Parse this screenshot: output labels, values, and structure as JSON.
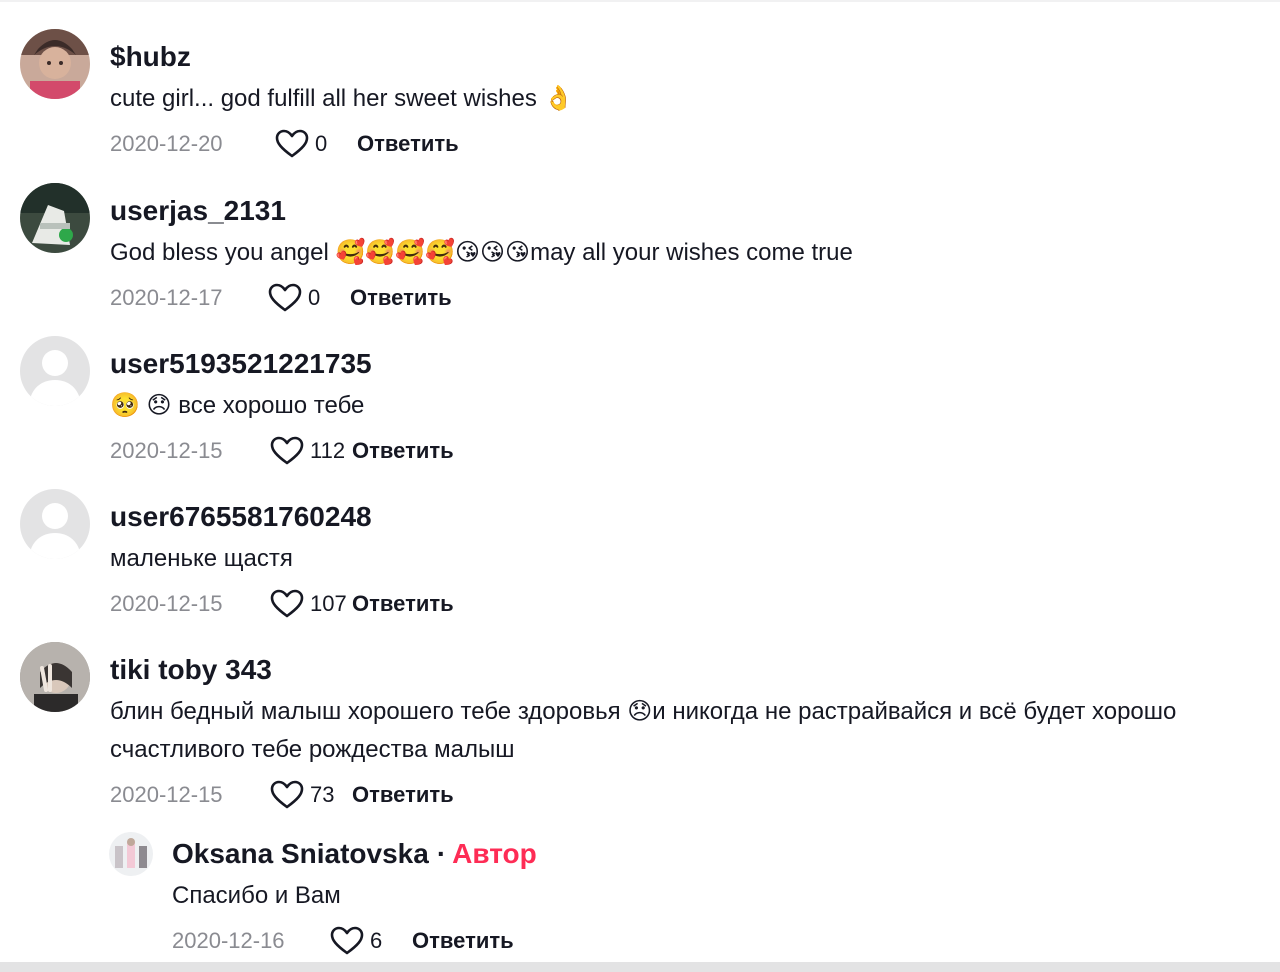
{
  "comments": [
    {
      "username": "$hubz",
      "text": "cute girl... god fulfill all her sweet wishes 👌",
      "date": "2020-12-20",
      "likes": "0",
      "reply_label": "Ответить",
      "avatar": "photo-avatar"
    },
    {
      "username": "userjas_2131",
      "text": "God bless you angel 🥰🥰🥰🥰😘😘😘may all your wishes come true",
      "date": "2020-12-17",
      "likes": "0",
      "reply_label": "Ответить",
      "avatar": "photo-avatar"
    },
    {
      "username": "user5193521221735",
      "text": "🥺 😞 все хорошо тебе",
      "date": "2020-12-15",
      "likes": "112",
      "reply_label": "Ответить",
      "avatar": "default-avatar"
    },
    {
      "username": "user6765581760248",
      "text": "маленьке щастя",
      "date": "2020-12-15",
      "likes": "107",
      "reply_label": "Ответить",
      "avatar": "default-avatar"
    },
    {
      "username": "tiki toby 343",
      "text": "блин бедный малыш хорошего тебе здоровья 😞и никогда не растрайвайся и всё будет хорошо счастливого тебе рождества малыш",
      "date": "2020-12-15",
      "likes": "73",
      "reply_label": "Ответить",
      "avatar": "photo-avatar"
    }
  ],
  "reply": {
    "username": "Oksana Sniatovska",
    "separator": "·",
    "author_tag": "Автор",
    "text": "Спасибо и Вам",
    "date": "2020-12-16",
    "likes": "6",
    "reply_label": "Ответить",
    "avatar": "photo-avatar"
  },
  "colors": {
    "author_tag": "#fe2c55",
    "date": "#8a8b91",
    "text": "#161823"
  },
  "icons": {
    "like": "heart-outline-icon"
  }
}
